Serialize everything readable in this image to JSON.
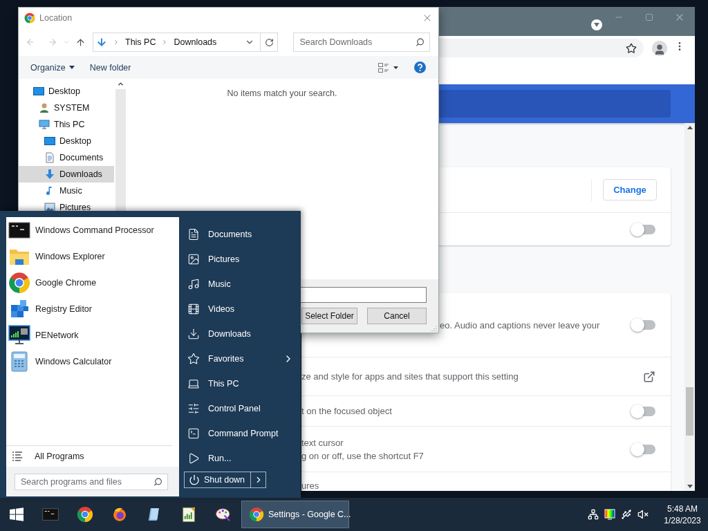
{
  "browser": {
    "cards": [
      {
        "rows": [
          {
            "kind": "button",
            "label": "Change"
          },
          {
            "kind": "toggle",
            "on": false
          }
        ]
      },
      {
        "rows": [
          {
            "kind": "toggle",
            "lines": [
              "eo. Audio and captions never leave your"
            ],
            "on": false
          },
          {
            "kind": "link",
            "lines": [
              "ze and style for apps and sites that support this setting"
            ]
          },
          {
            "kind": "toggle",
            "lines": [
              "t on the focused object"
            ],
            "on": false
          },
          {
            "kind": "toggle",
            "lines": [
              "text cursor",
              "g on or off, use the shortcut F7"
            ],
            "on": false
          },
          {
            "kind": "text",
            "lines": [
              "ures"
            ]
          }
        ]
      }
    ]
  },
  "dialog": {
    "title": "Location",
    "breadcrumb": [
      "This PC",
      "Downloads"
    ],
    "search": {
      "placeholder": "Search Downloads"
    },
    "commands": [
      "Organize",
      "New folder"
    ],
    "nav": [
      {
        "label": "Desktop",
        "kind": "desktop",
        "selected": false,
        "children": [
          {
            "label": "SYSTEM",
            "kind": "user",
            "selected": false
          },
          {
            "label": "This PC",
            "kind": "pc",
            "selected": false,
            "children": [
              {
                "label": "Desktop",
                "kind": "desktop",
                "selected": false
              },
              {
                "label": "Documents",
                "kind": "documents",
                "selected": false
              },
              {
                "label": "Downloads",
                "kind": "downloads",
                "selected": true
              },
              {
                "label": "Music",
                "kind": "music",
                "selected": false
              },
              {
                "label": "Pictures",
                "kind": "pictures",
                "selected": false
              }
            ]
          }
        ]
      }
    ],
    "empty_message": "No items match your search.",
    "buttons": [
      "Select Folder",
      "Cancel"
    ]
  },
  "start_menu": {
    "programs": [
      {
        "label": "Windows Command Processor",
        "kind": "cmd"
      },
      {
        "label": "Windows Explorer",
        "kind": "explorer"
      },
      {
        "label": "Google Chrome",
        "kind": "chrome"
      },
      {
        "label": "Registry Editor",
        "kind": "registry"
      },
      {
        "label": "PENetwork",
        "kind": "network"
      },
      {
        "label": "Windows Calculator",
        "kind": "calculator"
      }
    ],
    "all_programs": "All Programs",
    "search": {
      "placeholder": "Search programs and files"
    },
    "places": [
      {
        "label": "Documents",
        "kind": "documents"
      },
      {
        "label": "Pictures",
        "kind": "pictures"
      },
      {
        "label": "Music",
        "kind": "music"
      },
      {
        "label": "Videos",
        "kind": "videos"
      },
      {
        "label": "Downloads",
        "kind": "downloads"
      },
      {
        "label": "Favorites",
        "kind": "favorites",
        "submenu": true
      },
      {
        "label": "This PC",
        "kind": "pc"
      },
      {
        "label": "Control Panel",
        "kind": "control"
      },
      {
        "label": "Command Prompt",
        "kind": "cmd"
      },
      {
        "label": "Run...",
        "kind": "run"
      }
    ],
    "shutdown": "Shut down"
  },
  "taskbar": {
    "apps": [
      {
        "kind": "cmd"
      },
      {
        "kind": "chrome"
      },
      {
        "kind": "firefox"
      },
      {
        "kind": "notepad"
      },
      {
        "kind": "chart"
      },
      {
        "kind": "paint"
      }
    ],
    "windows": [
      {
        "label": "Settings - Google C...",
        "selected": true
      }
    ],
    "clock": {
      "time": "5:48 AM",
      "date": "1/28/2023"
    }
  }
}
